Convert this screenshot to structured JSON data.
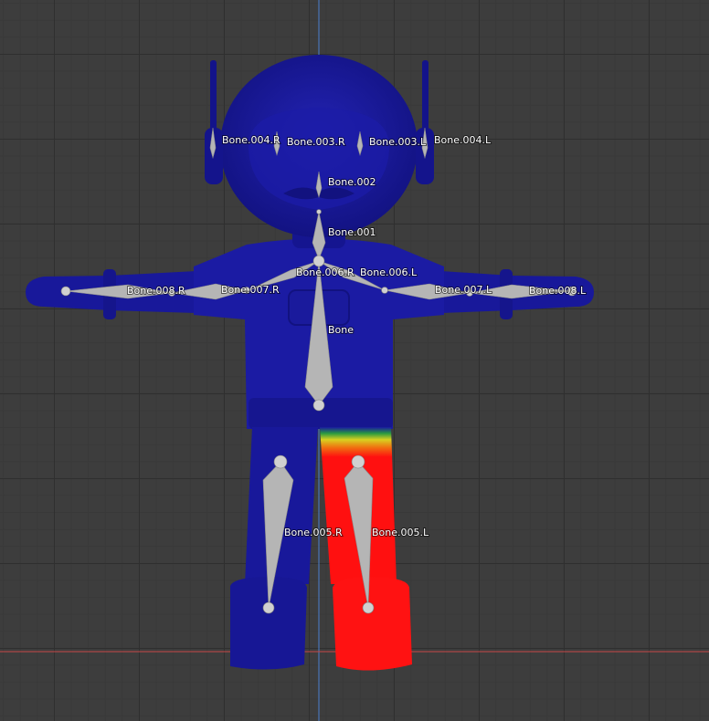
{
  "viewport": {
    "mode": "weight-paint",
    "axis_colors": {
      "x_axis": "#c84646",
      "z_axis": "#4a7fd0"
    },
    "colors": {
      "mesh_blue": "#1a1aa0",
      "weight_red": "#ff1010",
      "bone_fill": "#b5b5b5"
    }
  },
  "bones": [
    {
      "id": "bone-004-r",
      "label": "Bone.004.R"
    },
    {
      "id": "bone-003-r",
      "label": "Bone.003.R"
    },
    {
      "id": "bone-003-l",
      "label": "Bone.003.L"
    },
    {
      "id": "bone-004-l",
      "label": "Bone.004.L"
    },
    {
      "id": "bone-002",
      "label": "Bone.002"
    },
    {
      "id": "bone-001",
      "label": "Bone.001"
    },
    {
      "id": "bone-006-r",
      "label": "Bone.006.R"
    },
    {
      "id": "bone-006-l",
      "label": "Bone.006.L"
    },
    {
      "id": "bone-008-r",
      "label": "Bone.008.R"
    },
    {
      "id": "bone-007-r",
      "label": "Bone.007.R"
    },
    {
      "id": "bone-007-l",
      "label": "Bone.007.L"
    },
    {
      "id": "bone-008-l",
      "label": "Bone.008.L"
    },
    {
      "id": "bone",
      "label": "Bone"
    },
    {
      "id": "bone-005-r",
      "label": "Bone.005.R"
    },
    {
      "id": "bone-005-l",
      "label": "Bone.005.L"
    }
  ]
}
